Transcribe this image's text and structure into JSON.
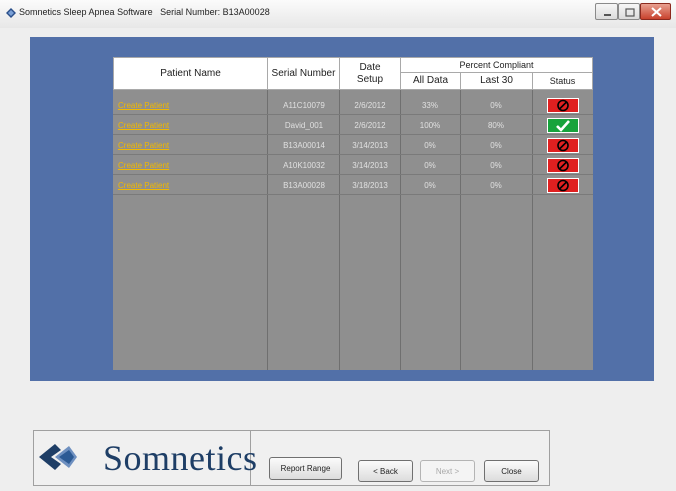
{
  "window": {
    "app_name": "Somnetics Sleep Apnea Software",
    "serial_label": "Serial Number:",
    "serial_number": "B13A00028"
  },
  "table": {
    "headers": {
      "patient_name": "Patient Name",
      "serial_number": "Serial Number",
      "date_setup_1": "Date",
      "date_setup_2": "Setup",
      "percent_compliant": "Percent Compliant",
      "all_data": "All Data",
      "last_30": "Last 30",
      "status": "Status"
    },
    "rows": [
      {
        "patient": "Create Patient",
        "serial": "A11C10079",
        "date": "2/6/2012",
        "all_data": "33%",
        "last_30": "0%",
        "status": "noncompliant"
      },
      {
        "patient": "Create Patient",
        "serial": "David_001",
        "date": "2/6/2012",
        "all_data": "100%",
        "last_30": "80%",
        "status": "compliant"
      },
      {
        "patient": "Create Patient",
        "serial": "B13A00014",
        "date": "3/14/2013",
        "all_data": "0%",
        "last_30": "0%",
        "status": "noncompliant"
      },
      {
        "patient": "Create Patient",
        "serial": "A10K10032",
        "date": "3/14/2013",
        "all_data": "0%",
        "last_30": "0%",
        "status": "noncompliant"
      },
      {
        "patient": "Create Patient",
        "serial": "B13A00028",
        "date": "3/18/2013",
        "all_data": "0%",
        "last_30": "0%",
        "status": "noncompliant"
      }
    ]
  },
  "logo": {
    "text": "Somnetics"
  },
  "buttons": {
    "report_range": "Report Range",
    "back": "< Back",
    "next": "Next >",
    "close": "Close"
  },
  "colors": {
    "panel_blue": "#5270a8",
    "grid_gray": "#8f8f8f",
    "link_yellow": "#f0b800",
    "status_red": "#e02020",
    "status_green": "#17a33c",
    "logo_navy": "#1e3e66"
  },
  "icons": {
    "app": "somnetics-diamond-icon",
    "noncompliant": "prohibited-circle-icon",
    "compliant": "checkmark-icon"
  }
}
